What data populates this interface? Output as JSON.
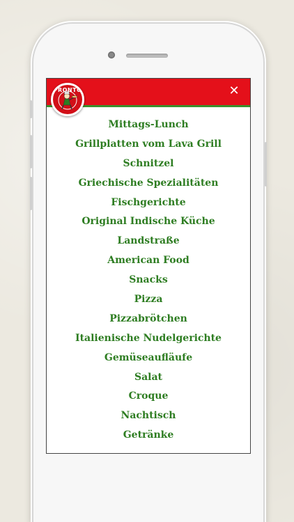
{
  "header": {
    "logo_text": "PRONTO",
    "close_icon": "close-icon"
  },
  "colors": {
    "header_red": "#e4101a",
    "accent_green": "#2e7d22"
  },
  "menu": {
    "items": [
      "Mittags-Lunch",
      "Grillplatten vom Lava Grill",
      "Schnitzel",
      "Griechische Spezialitäten",
      "Fischgerichte",
      "Original Indische Küche",
      "Landstraße",
      "American Food",
      "Snacks",
      "Pizza",
      "Pizzabrötchen",
      "Italienische Nudelgerichte",
      "Gemüseaufläufe",
      "Salat",
      "Croque",
      "Nachtisch",
      "Getränke"
    ]
  }
}
